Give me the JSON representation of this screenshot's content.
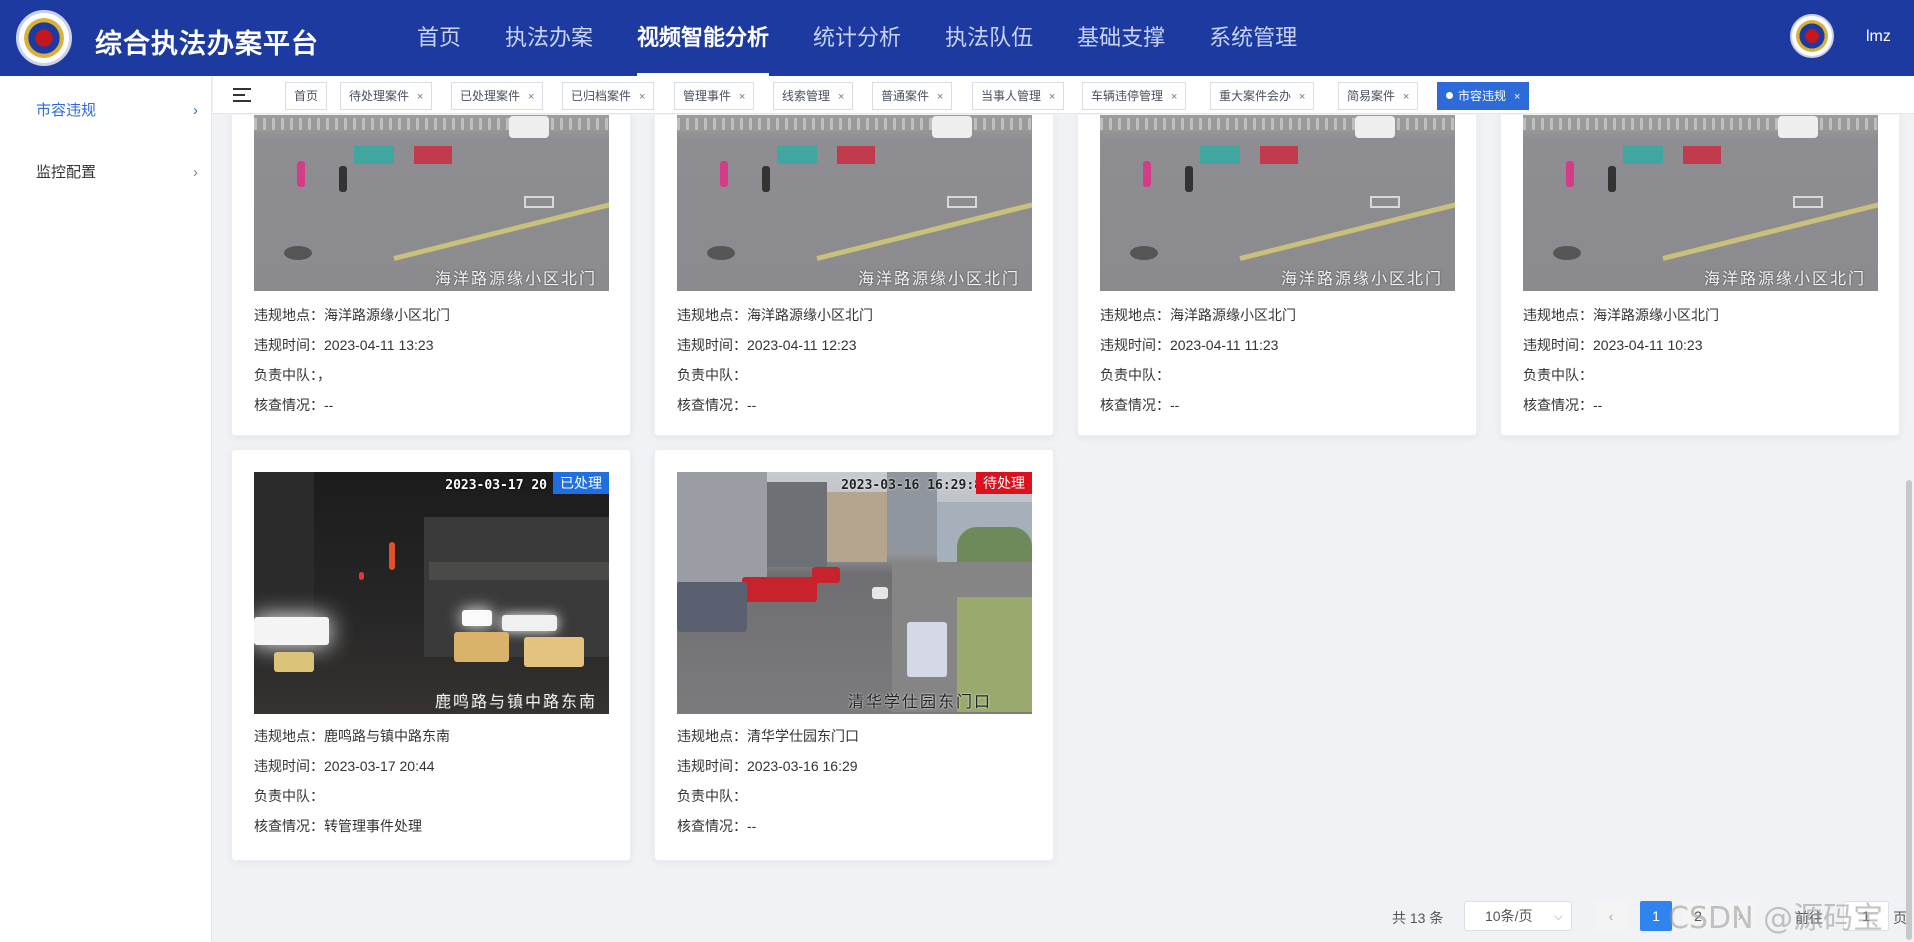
{
  "app": {
    "title": "综合执法办案平台",
    "user": "lmz"
  },
  "nav": [
    "首页",
    "执法办案",
    "视频智能分析",
    "统计分析",
    "执法队伍",
    "基础支撑",
    "系统管理"
  ],
  "sidebar": {
    "items": [
      {
        "label": "市容违规",
        "icon": "chevron-right-icon"
      },
      {
        "label": "监控配置",
        "icon": "chevron-right-icon"
      }
    ]
  },
  "tabs": [
    {
      "label": "首页",
      "closable": false
    },
    {
      "label": "待处理案件",
      "closable": true
    },
    {
      "label": "已处理案件",
      "closable": true
    },
    {
      "label": "已归档案件",
      "closable": true
    },
    {
      "label": "管理事件",
      "closable": true
    },
    {
      "label": "线索管理",
      "closable": true
    },
    {
      "label": "普通案件",
      "closable": true
    },
    {
      "label": "当事人管理",
      "closable": true
    },
    {
      "label": "车辆违停管理",
      "closable": true
    },
    {
      "label": "重大案件会办",
      "closable": true
    },
    {
      "label": "简易案件",
      "closable": true
    },
    {
      "label": "市容违规",
      "closable": true,
      "active": true
    }
  ],
  "tab_close": "×",
  "labels": {
    "location": "违规地点：",
    "time": "违规时间：",
    "team": "负责中队：",
    "check": "核查情况："
  },
  "cards": [
    {
      "location": "海洋路源缘小区北门",
      "time": "2023-04-11 13:23",
      "team": "，",
      "check": "--",
      "caption": "海洋路源缘小区北门"
    },
    {
      "location": "海洋路源缘小区北门",
      "time": "2023-04-11 12:23",
      "team": "",
      "check": "--",
      "caption": "海洋路源缘小区北门"
    },
    {
      "location": "海洋路源缘小区北门",
      "time": "2023-04-11 11:23",
      "team": "",
      "check": "--",
      "caption": "海洋路源缘小区北门"
    },
    {
      "location": "海洋路源缘小区北门",
      "time": "2023-04-11 10:23",
      "team": "",
      "check": "--",
      "caption": "海洋路源缘小区北门"
    },
    {
      "location": "鹿鸣路与镇中路东南",
      "time": "2023-03-17 20:44",
      "team": "",
      "check": "转管理事件处理",
      "caption": "鹿鸣路与镇中路东南",
      "timestamp": "2023-03-17 20",
      "status": "已处理"
    },
    {
      "location": "清华学仕园东门口",
      "time": "2023-03-16 16:29",
      "team": "",
      "check": "--",
      "caption": "清华学仕园东门口",
      "timestamp": "2023-03-16 16:29:8",
      "status": "待处理"
    }
  ],
  "pagination": {
    "total": "共 13 条",
    "page_size": "10条/页",
    "prev": "‹",
    "current": "1",
    "next_page": "2",
    "next": "›",
    "jump_label": "前往",
    "jump_value": "1",
    "jump_suffix": "页"
  },
  "watermark": "CSDN @源码宝",
  "colors": {
    "header": "#1d3aa0",
    "active_tab": "#2f6bd8",
    "badge_done": "#1f6fe0",
    "badge_todo": "#d9121d"
  }
}
